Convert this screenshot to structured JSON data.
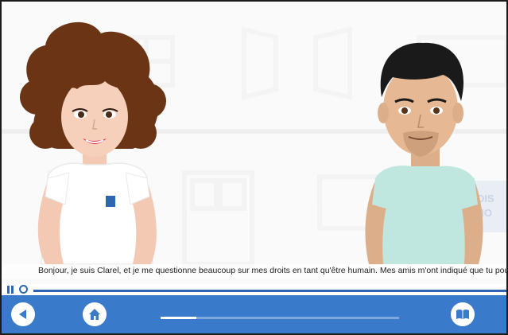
{
  "subtitle": {
    "text": "Bonjour, je suis Clarel, et je me questionne beaucoup sur mes droits en tant qu'être humain. Mes amis m'ont indiqué que tu pourrais m'aider"
  },
  "playback": {
    "state": "playing",
    "progress": 0.05
  },
  "toolbar": {
    "back_icon": "triangle-left-icon",
    "home_icon": "house-icon",
    "book_icon": "open-book-icon",
    "slide_progress": 0.15
  },
  "background": {
    "sign_text": "DIS\nMO"
  },
  "colors": {
    "toolbar_blue": "#3a7acb",
    "track_blue": "#2e65b3"
  }
}
